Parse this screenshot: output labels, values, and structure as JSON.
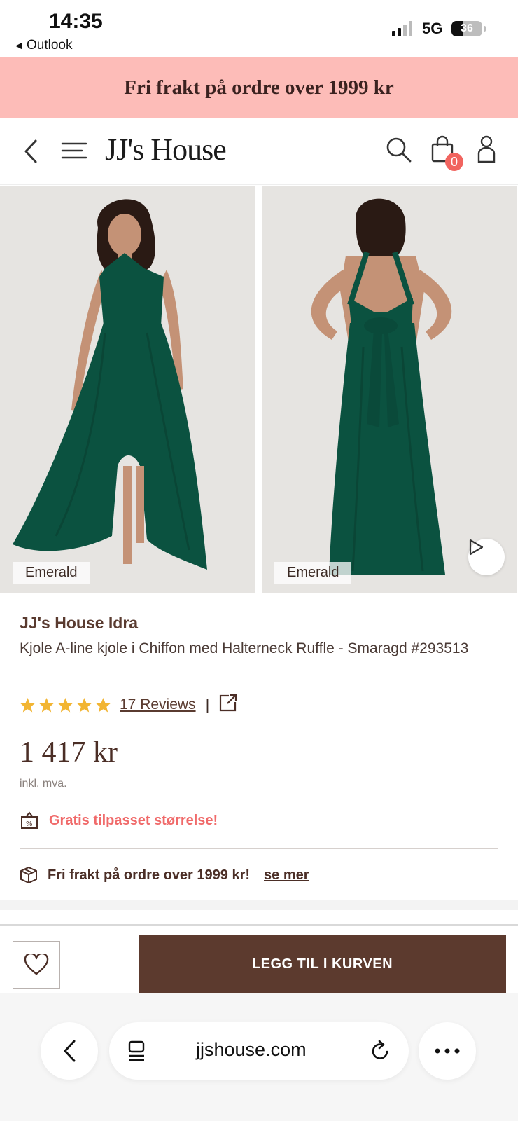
{
  "status_bar": {
    "time": "14:35",
    "back_app": "Outlook",
    "network": "5G",
    "battery": "36",
    "battery_level": 0.36
  },
  "promo_banner": {
    "text": "Fri frakt på ordre over 1999 kr"
  },
  "header": {
    "logo": "JJ's House",
    "cart_count": "0",
    "icons": [
      "back-chevron-icon",
      "menu-icon",
      "search-icon",
      "cart-icon",
      "user-icon"
    ]
  },
  "gallery": {
    "images": [
      {
        "color_label": "Emerald",
        "view": "front"
      },
      {
        "color_label": "Emerald",
        "view": "back"
      }
    ],
    "dress_color": "#0b5240",
    "background_color": "#e6e4e1"
  },
  "product": {
    "brand": "JJ's House Idra",
    "title": "Kjole A-line kjole i Chiffon med Halterneck Ruffle - Smaragd #293513",
    "rating_stars": 5,
    "reviews_label": "17 Reviews",
    "price": "1 417 kr",
    "vat_note": "inkl. mva.",
    "custom_size_note": "Gratis tilpasset størrelse!",
    "free_shipping": "Fri frakt på ordre over 1999 kr!",
    "free_shipping_link": "se mer"
  },
  "actions": {
    "add_to_cart": "LEGG TIL I KURVEN"
  },
  "browser": {
    "url": "jjshouse.com"
  },
  "colors": {
    "promo_bg": "#fdbcb8",
    "accent_brown": "#5c3a2e",
    "badge_red": "#f1645f",
    "star_yellow": "#f2b533",
    "note_pink": "#f06a6a"
  }
}
